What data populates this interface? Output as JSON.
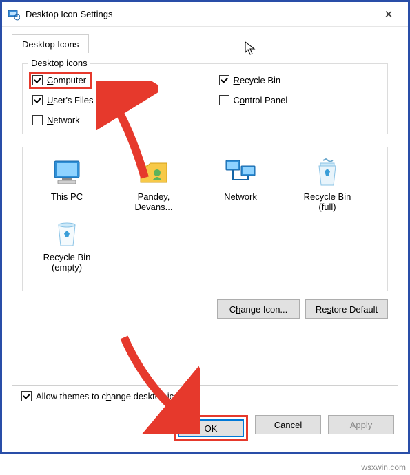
{
  "window": {
    "title": "Desktop Icon Settings",
    "close_glyph": "✕"
  },
  "tab": {
    "label": "Desktop Icons"
  },
  "group": {
    "legend": "Desktop icons",
    "checks": [
      {
        "letter": "C",
        "rest": "omputer",
        "checked": true,
        "highlight": true
      },
      {
        "letter": "R",
        "rest": "ecycle Bin",
        "checked": true
      },
      {
        "letter": "U",
        "rest": "ser's Files",
        "checked": true
      },
      {
        "pre": "C",
        "letter": "o",
        "rest": "ntrol Panel",
        "checked": false
      },
      {
        "letter": "N",
        "rest": "etwork",
        "checked": false
      }
    ]
  },
  "icons": [
    {
      "name": "this-pc",
      "label1": "This PC",
      "label2": ""
    },
    {
      "name": "user-folder",
      "label1": "Pandey,",
      "label2": "Devans..."
    },
    {
      "name": "network",
      "label1": "Network",
      "label2": ""
    },
    {
      "name": "recycle-full",
      "label1": "Recycle Bin",
      "label2": "(full)"
    },
    {
      "name": "recycle-empty",
      "label1": "Recycle Bin",
      "label2": "(empty)"
    }
  ],
  "buttons": {
    "change_icon": "Change Icon...",
    "restore": "Restore Default",
    "ok": "OK",
    "cancel": "Cancel",
    "apply": "Apply"
  },
  "allow_themes": {
    "pre": "Allow themes to c",
    "letter": "h",
    "rest": "ange desktop icons",
    "checked": true
  },
  "watermark": "wsxwin.com"
}
